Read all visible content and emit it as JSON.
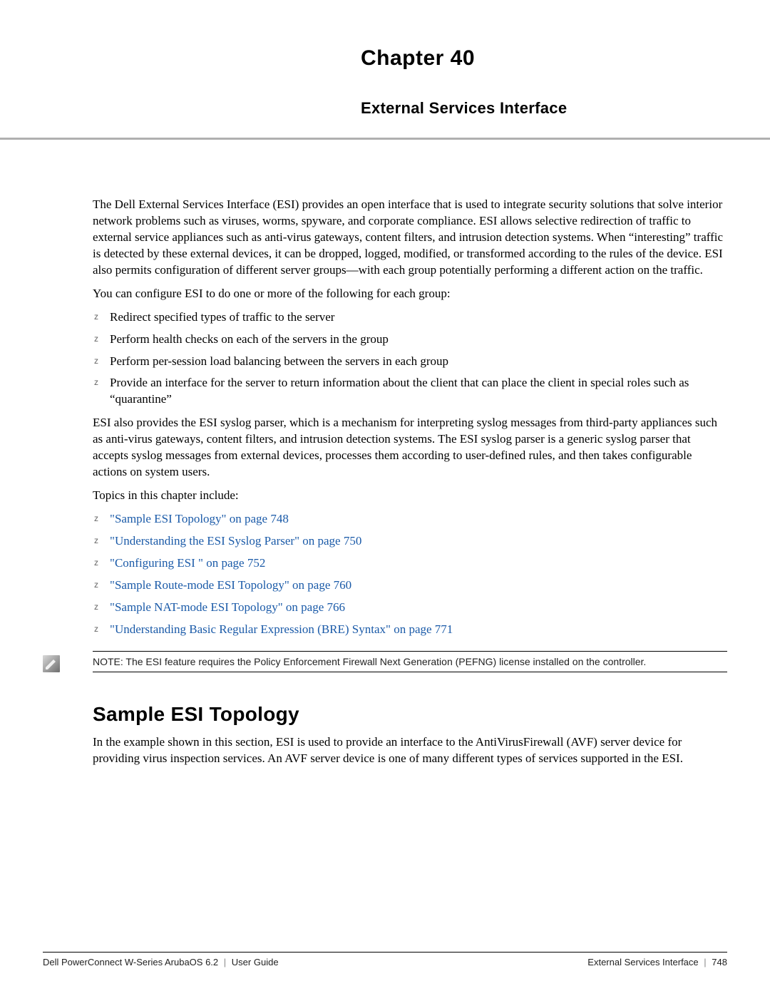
{
  "header": {
    "chapter_label": "Chapter 40",
    "chapter_title": "External Services Interface"
  },
  "body": {
    "para1": "The Dell External Services Interface (ESI) provides an open interface that is used to integrate security solutions that solve interior network problems such as viruses, worms, spyware, and corporate compliance. ESI allows selective redirection of traffic to external service appliances such as anti-virus gateways, content filters, and intrusion detection systems. When “interesting” traffic is detected by these external devices, it can be dropped, logged, modified, or transformed according to the rules of the device. ESI also permits configuration of different server groups—with each group potentially performing a different action on the traffic.",
    "para2": "You can configure ESI to do one or more of the following for each group:",
    "actions": [
      "Redirect specified types of traffic to the server",
      "Perform health checks on each of the servers in the group",
      "Perform per-session load balancing between the servers in each group",
      "Provide an interface for the server to return information about the client that can place the client in special roles such as “quarantine”"
    ],
    "para3": "ESI also provides the ESI syslog parser, which is a mechanism for interpreting syslog messages from third-party appliances such as anti-virus gateways, content filters, and intrusion detection systems. The ESI syslog parser is a generic syslog parser that accepts syslog messages from external devices, processes them according to user-defined rules, and then takes configurable actions on system users.",
    "para4": "Topics in this chapter include:",
    "topics": [
      "\"Sample ESI Topology\" on page 748",
      "\"Understanding the ESI Syslog Parser\" on page 750",
      "\"Configuring ESI \" on page 752",
      "\"Sample Route-mode ESI Topology\" on page 760",
      "\"Sample NAT-mode ESI Topology\" on page 766",
      "\"Understanding Basic Regular Expression (BRE) Syntax\" on page 771"
    ],
    "note": "NOTE: The ESI feature requires the Policy Enforcement Firewall Next Generation (PEFNG) license installed on the controller.",
    "section_heading": "Sample ESI Topology",
    "section_para": "In the example shown in this section, ESI is used to provide an interface to the AntiVirusFirewall (AVF) server device for providing virus inspection services. An AVF server device is one of many different types of services supported in the ESI."
  },
  "footer": {
    "left_product": "Dell PowerConnect W-Series ArubaOS 6.2",
    "left_doc": "User Guide",
    "right_section": "External Services Interface",
    "right_page": "748",
    "separator": "|"
  }
}
